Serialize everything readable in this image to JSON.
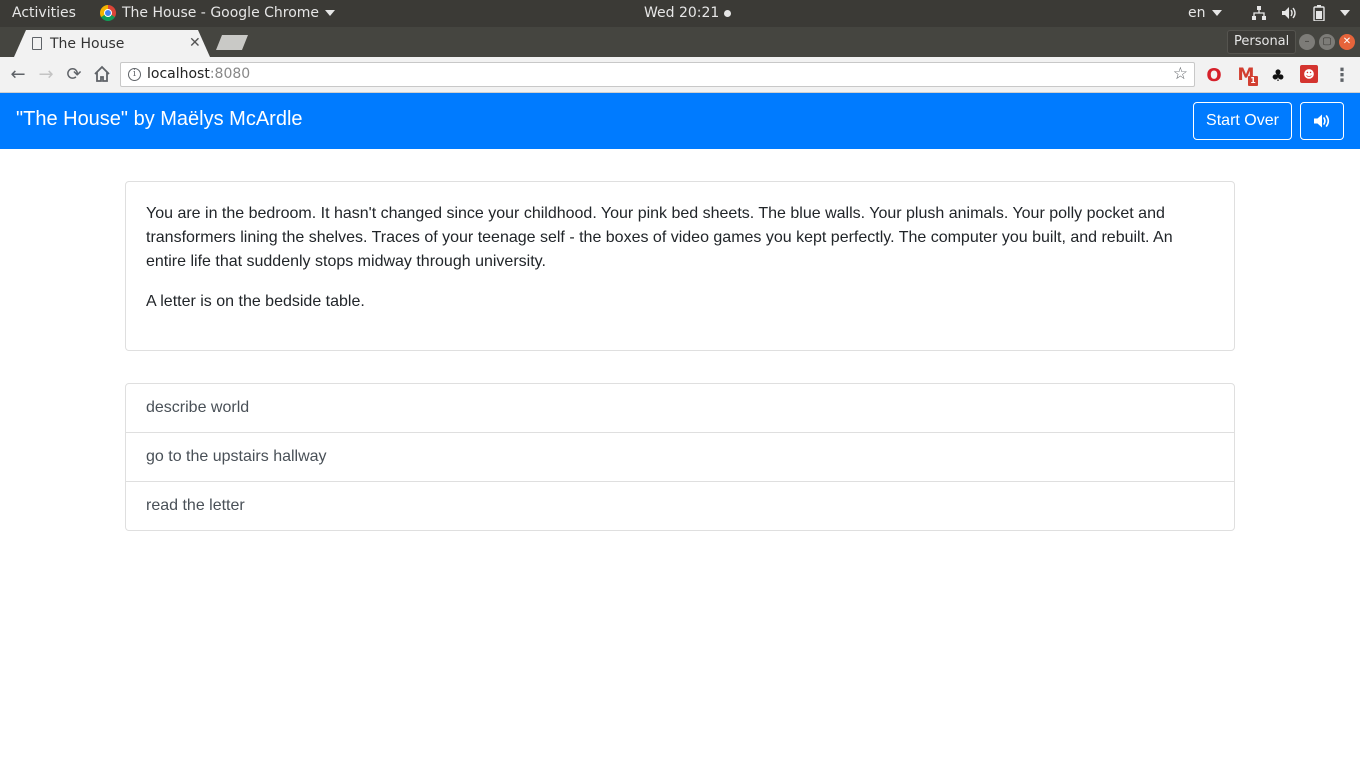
{
  "system_bar": {
    "activities": "Activities",
    "app_name": "The House - Google Chrome",
    "clock": "Wed 20:21",
    "language": "en"
  },
  "browser": {
    "tab_title": "The House",
    "profile": "Personal",
    "url_host": "localhost",
    "url_port": ":8080",
    "gmail_badge": "1"
  },
  "page": {
    "title": "\"The House\" by Maëlys McArdle",
    "start_over_label": "Start Over",
    "description": [
      "You are in the bedroom. It hasn't changed since your childhood. Your pink bed sheets. The blue walls. Your plush animals. Your polly pocket and transformers lining the shelves. Traces of your teenage self - the boxes of video games you kept perfectly. The computer you built, and rebuilt. An entire life that suddenly stops midway through university.",
      "A letter is on the bedside table."
    ],
    "actions": [
      "describe world",
      "go to the upstairs hallway",
      "read the letter"
    ]
  },
  "colors": {
    "navbar": "#007bff",
    "topbar": "#3b3a36"
  },
  "icons": {
    "sound": "volume-icon",
    "bookmark": "star-icon"
  }
}
